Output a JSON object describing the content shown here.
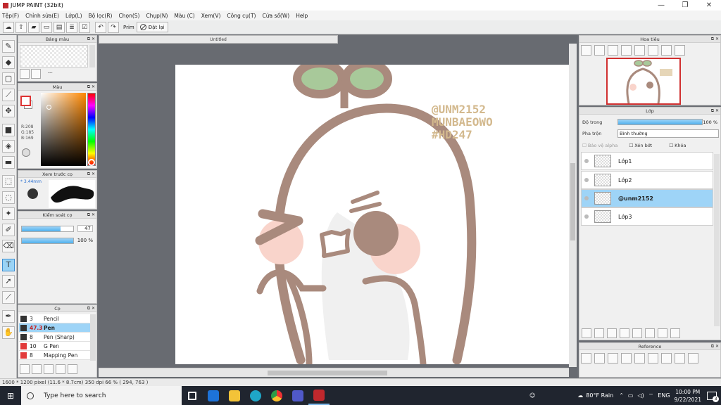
{
  "window": {
    "title": "JUMP PAINT (32bit)",
    "controls": [
      "—",
      "❐",
      "✕"
    ]
  },
  "menu": [
    "Tệp(F)",
    "Chỉnh sửa(E)",
    "Lớp(L)",
    "Bộ lọc(R)",
    "Chọn(S)",
    "Chụp(N)",
    "Màu (C)",
    "Xem(V)",
    "Công cụ(T)",
    "Cửa sổ(W)",
    "Help"
  ],
  "toolbar": {
    "print_label": "Prim",
    "undo_label": "Đặt lại"
  },
  "panels": {
    "palette": {
      "title": "Bảng màu",
      "more": "---"
    },
    "color": {
      "title": "Màu",
      "r": "R:208",
      "g": "G:185",
      "b": "B:169"
    },
    "brush_preview": {
      "title": "Xem trước cọ",
      "size": "* 3.44mm"
    },
    "stabilizer": {
      "title": "Kiểm soát cọ",
      "value1": "47",
      "value2": "100 %",
      "fill1": 0.75,
      "fill2": 1.0
    },
    "brush": {
      "title": "Cọ",
      "items": [
        {
          "size": "3",
          "name": "Pencil",
          "color": "#333333"
        },
        {
          "size": "47.3",
          "name": "Pen",
          "color": "#333333"
        },
        {
          "size": "8",
          "name": "Pen (Sharp)",
          "color": "#333333"
        },
        {
          "size": "10",
          "name": "G Pen",
          "color": "#e23a3a"
        },
        {
          "size": "8",
          "name": "Mapping Pen",
          "color": "#e23a3a"
        }
      ]
    },
    "navigator": {
      "title": "Hoa tiêu"
    },
    "layers": {
      "title": "Lớp",
      "opacity_label": "Độ trong",
      "opacity_value": "100 %",
      "blend_label": "Pha trộn",
      "blend_value": "Bình thường",
      "protect_alpha": "Bảo vệ alpha",
      "clipping": "Xén bớt",
      "lock": "Khóa",
      "items": [
        "Lớp1",
        "Lớp2",
        "@unm2152",
        "Lớp3"
      ]
    },
    "reference": {
      "title": "Reference"
    }
  },
  "document": {
    "tab": "Untitled",
    "watermark": [
      "@UNM2152",
      "MUNBAEOWO",
      "#HD247"
    ]
  },
  "status": "1600 * 1200 pixel   (11.6 * 8.7cm)   350 dpi   66 %   ( 294, 763 )",
  "taskbar": {
    "search_placeholder": "Type here to search",
    "weather": "80°F Rain",
    "lang": "ENG",
    "time": "10:00 PM",
    "date": "9/22/2021",
    "badge": "3"
  },
  "colors": {
    "brand": "#c0282d",
    "accent": "#9ed4f7",
    "line_art": "#a98a7d",
    "leaf": "#a8c99a",
    "blush": "#f9d4cb"
  }
}
